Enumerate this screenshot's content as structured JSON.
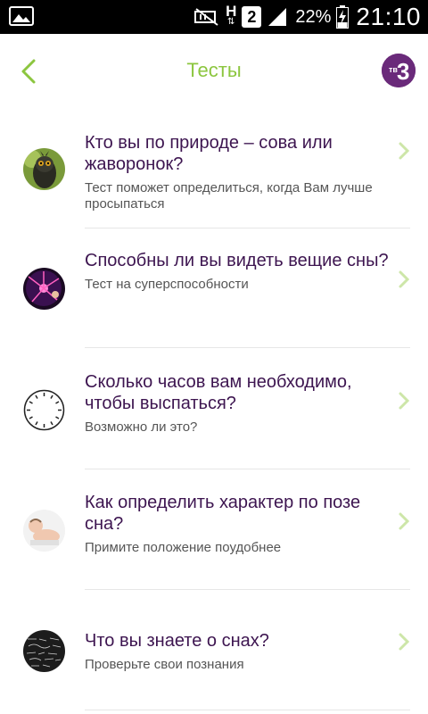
{
  "status_bar": {
    "battery": "22%",
    "network": "H",
    "sim": "2",
    "time": "21:10"
  },
  "header": {
    "title": "Тесты",
    "logo_text": "тв3"
  },
  "colors": {
    "accent": "#8cc63f",
    "title_text": "#3d1550",
    "logo_bg": "#6a2a7a"
  },
  "tests": [
    {
      "title": "Кто вы по природе – сова или жаворонок?",
      "subtitle": "Тест поможет определиться, когда Вам лучше просыпаться",
      "thumb_icon": "owl-icon"
    },
    {
      "title": "Способны ли вы видеть вещие сны?",
      "subtitle": "Тест на суперспособности",
      "thumb_icon": "plasma-ball-icon"
    },
    {
      "title": "Сколько часов вам необходимо, чтобы выспаться?",
      "subtitle": " Возможно ли это?",
      "thumb_icon": "clock-icon"
    },
    {
      "title": "Как определить характер по позе сна?",
      "subtitle": "Примите положение поудобнее",
      "thumb_icon": "sleeping-baby-icon"
    },
    {
      "title": "Что вы  знаете о снах?",
      "subtitle": "Проверьте свои познания",
      "thumb_icon": "chalkboard-icon"
    }
  ]
}
